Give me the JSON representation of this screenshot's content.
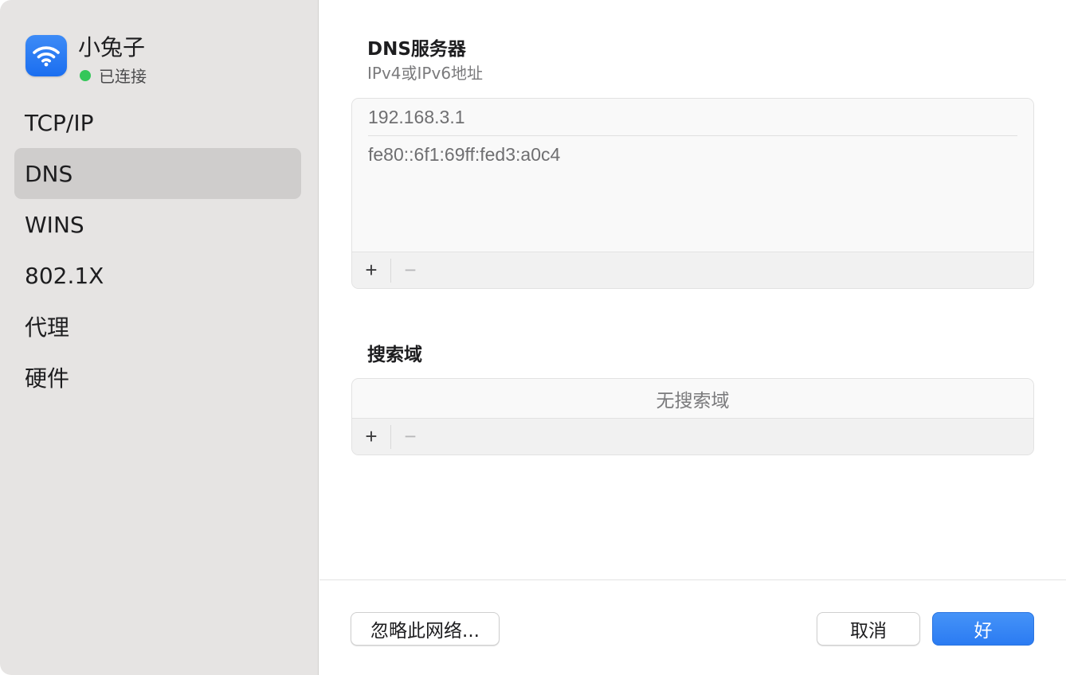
{
  "sidebar": {
    "network_name": "小兔子",
    "status": "已连接",
    "status_color": "#34c759",
    "icon": "wifi-icon",
    "items": [
      {
        "label": "TCP/IP",
        "selected": false
      },
      {
        "label": "DNS",
        "selected": true
      },
      {
        "label": "WINS",
        "selected": false
      },
      {
        "label": "802.1X",
        "selected": false
      },
      {
        "label": "代理",
        "selected": false
      },
      {
        "label": "硬件",
        "selected": false
      }
    ]
  },
  "dns": {
    "title": "DNS服务器",
    "subtitle": "IPv4或IPv6地址",
    "servers": [
      "192.168.3.1",
      "fe80::6f1:69ff:fed3:a0c4"
    ],
    "add_label": "+",
    "remove_label": "−"
  },
  "search_domains": {
    "title": "搜索域",
    "empty_text": "无搜索域",
    "add_label": "+",
    "remove_label": "−"
  },
  "footer": {
    "forget_label": "忽略此网络...",
    "cancel_label": "取消",
    "ok_label": "好",
    "accent_color": "#2b7bf2"
  }
}
